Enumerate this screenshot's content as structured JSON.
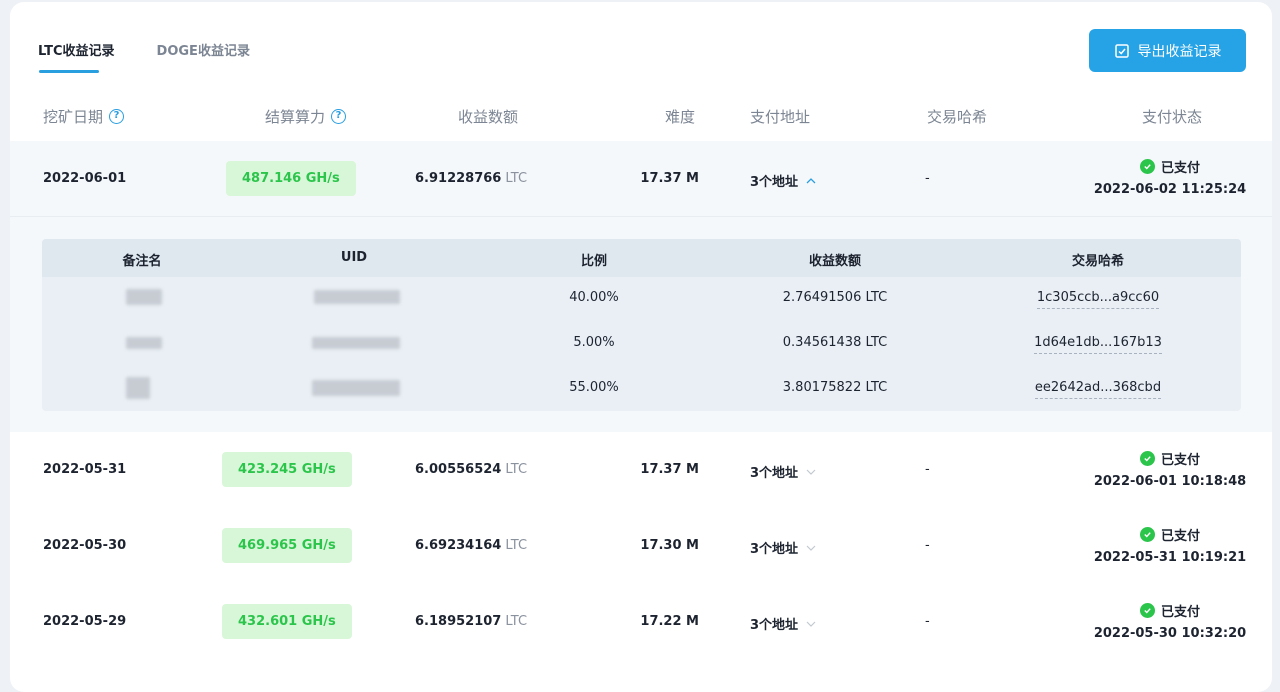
{
  "tabs": [
    {
      "label": "LTC收益记录",
      "active": true
    },
    {
      "label": "DOGE收益记录",
      "active": false
    }
  ],
  "export_label": "导出收益记录",
  "headers": {
    "date": "挖矿日期",
    "hashrate": "结算算力",
    "amount": "收益数额",
    "difficulty": "难度",
    "address": "支付地址",
    "txhash": "交易哈希",
    "status": "支付状态"
  },
  "rows": [
    {
      "date": "2022-06-01",
      "hashrate": "487.146 GH/s",
      "amount": "6.91228766",
      "unit": "LTC",
      "difficulty": "17.37 M",
      "address": "3个地址",
      "txhash": "-",
      "status": "已支付",
      "paid_at": "2022-06-02 11:25:24",
      "expanded": true
    },
    {
      "date": "2022-05-31",
      "hashrate": "423.245 GH/s",
      "amount": "6.00556524",
      "unit": "LTC",
      "difficulty": "17.37 M",
      "address": "3个地址",
      "txhash": "-",
      "status": "已支付",
      "paid_at": "2022-06-01 10:18:48",
      "expanded": false
    },
    {
      "date": "2022-05-30",
      "hashrate": "469.965 GH/s",
      "amount": "6.69234164",
      "unit": "LTC",
      "difficulty": "17.30 M",
      "address": "3个地址",
      "txhash": "-",
      "status": "已支付",
      "paid_at": "2022-05-31 10:19:21",
      "expanded": false
    },
    {
      "date": "2022-05-29",
      "hashrate": "432.601 GH/s",
      "amount": "6.18952107",
      "unit": "LTC",
      "difficulty": "17.22 M",
      "address": "3个地址",
      "txhash": "-",
      "status": "已支付",
      "paid_at": "2022-05-30 10:32:20",
      "expanded": false
    }
  ],
  "sub_headers": {
    "remark": "备注名",
    "uid": "UID",
    "ratio": "比例",
    "amount": "收益数额",
    "txhash": "交易哈希"
  },
  "sub_rows": [
    {
      "ratio": "40.00%",
      "amount": "2.76491506 LTC",
      "txhash": "1c305ccb...a9cc60"
    },
    {
      "ratio": "5.00%",
      "amount": "0.34561438 LTC",
      "txhash": "1d64e1db...167b13"
    },
    {
      "ratio": "55.00%",
      "amount": "3.80175822 LTC",
      "txhash": "ee2642ad...368cbd"
    }
  ],
  "colors": {
    "accent": "#26a3e6",
    "success": "#2cc54b",
    "pill_bg": "#d8f7d8"
  }
}
